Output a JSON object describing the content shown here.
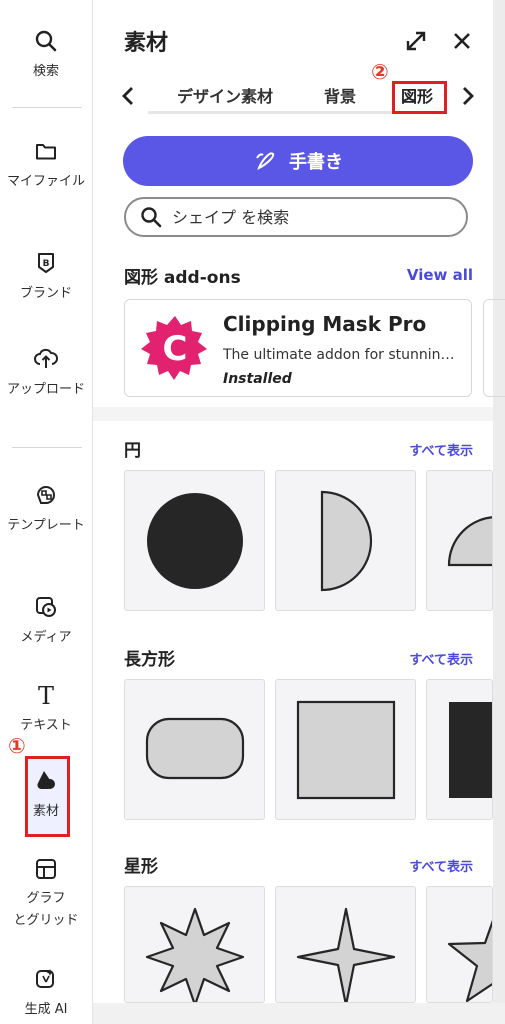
{
  "sidebar": {
    "items": [
      {
        "label": "検索",
        "icon": "search-icon"
      },
      {
        "label": "マイファイル",
        "icon": "folder-icon"
      },
      {
        "label": "ブランド",
        "icon": "brand-icon"
      },
      {
        "label": "アップロード",
        "icon": "upload-icon"
      },
      {
        "label": "テンプレート",
        "icon": "template-icon"
      },
      {
        "label": "メディア",
        "icon": "media-icon"
      },
      {
        "label": "テキスト",
        "icon": "text-icon"
      },
      {
        "label": "素材",
        "icon": "elements-icon"
      },
      {
        "label": "グラフ",
        "label2": "とグリッド",
        "icon": "grid-icon"
      },
      {
        "label": "生成 AI",
        "icon": "ai-icon"
      }
    ],
    "marker": "①"
  },
  "panel": {
    "title": "素材",
    "marker": "②",
    "tabs": [
      "デザイン素材",
      "背景",
      "図形"
    ],
    "active_tab": "図形",
    "draw_button": "手書き",
    "search_placeholder": "シェイプ を検索"
  },
  "addons": {
    "title": "図形 add-ons",
    "view_all": "View all",
    "card": {
      "name": "Clipping Mask Pro",
      "desc": "The ultimate addon for stunning visuals",
      "status": "Installed"
    }
  },
  "sections": [
    {
      "title": "円",
      "link": "すべて表示"
    },
    {
      "title": "長方形",
      "link": "すべて表示"
    },
    {
      "title": "星形",
      "link": "すべて表示"
    }
  ],
  "colors": {
    "accent": "#5a57e6",
    "link": "#4b4bd8",
    "highlight": "#e02020",
    "logo": "#e2226e",
    "shape_fill": "#d3d3d3",
    "shape_dark": "#262626"
  }
}
